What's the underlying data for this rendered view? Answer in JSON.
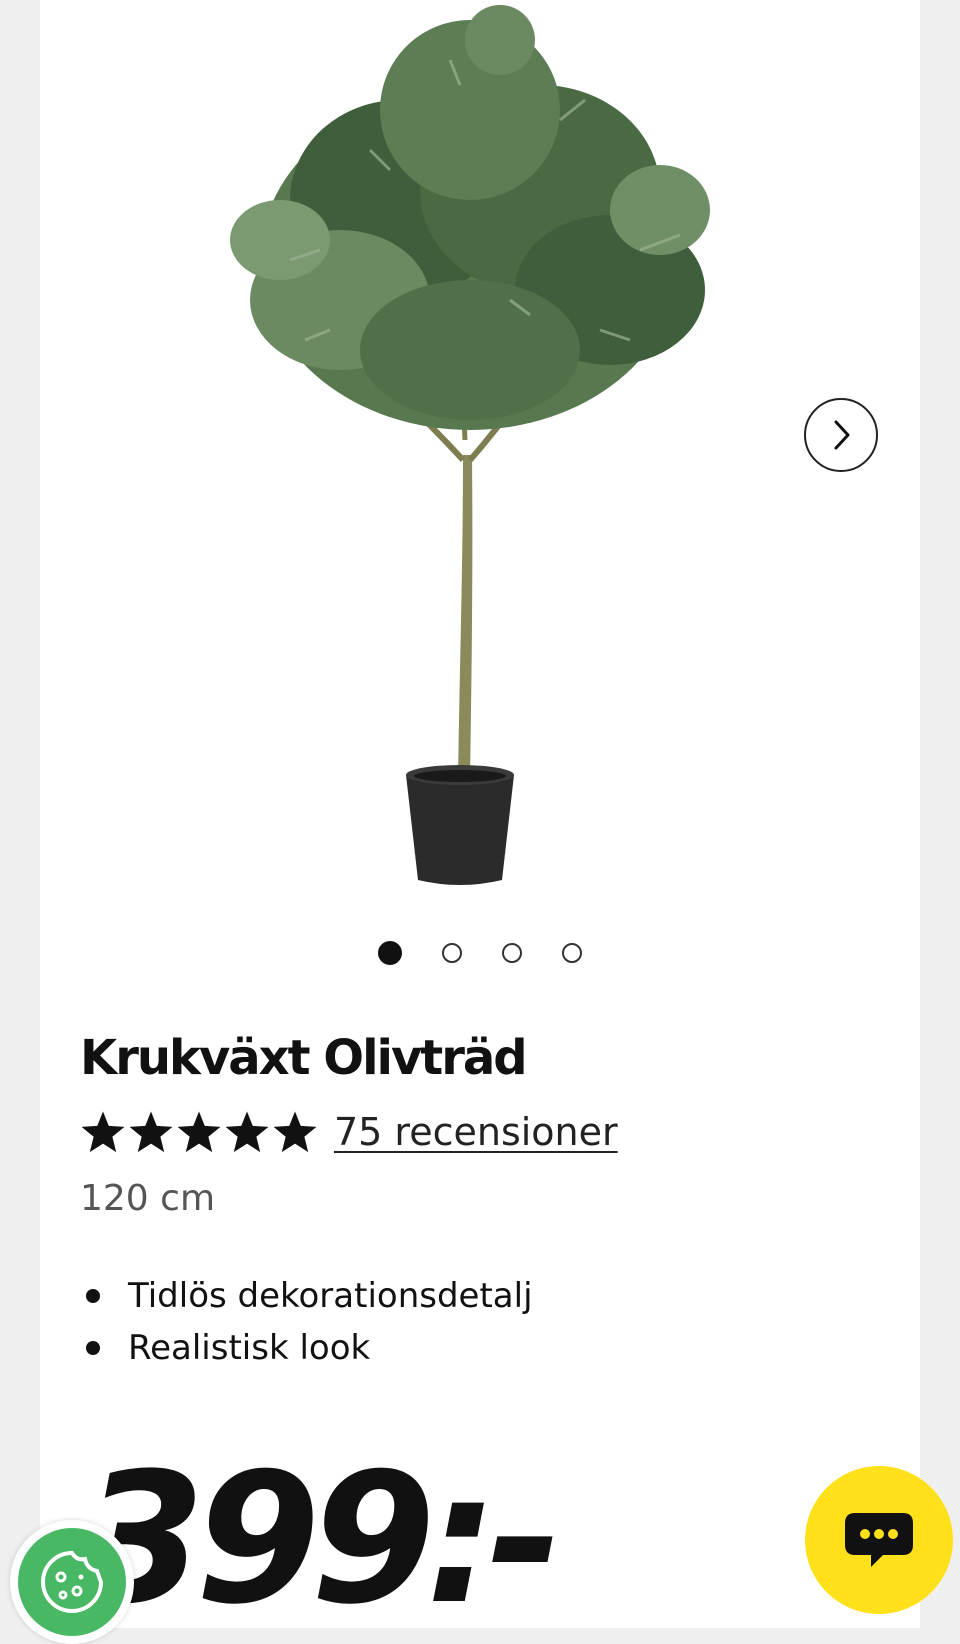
{
  "product": {
    "title": "Krukväxt Olivträd",
    "rating_stars": 5,
    "reviews_label": "75 recensioner",
    "size": "120 cm",
    "features": [
      "Tidlös dekorationsdetalj",
      "Realistisk look"
    ],
    "price": "399:-"
  },
  "gallery": {
    "image_count": 4,
    "active_index": 0,
    "next_icon": "chevron-right-icon"
  },
  "colors": {
    "chat_button": "#ffe11b",
    "cookie_button": "#48b864",
    "background": "#efefef"
  },
  "icons": {
    "chat": "chat-bubble-icon",
    "cookie": "cookie-icon"
  }
}
